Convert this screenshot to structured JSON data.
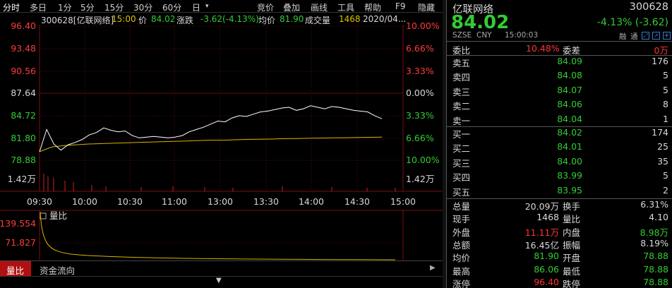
{
  "toolbar": {
    "left_items": [
      "分时",
      "多日",
      "1分",
      "5分",
      "15分",
      "30分",
      "60分",
      "日"
    ],
    "right_items": [
      "竞价",
      "叠加",
      "画线",
      "工具",
      "帮助",
      "F9",
      "隐藏"
    ]
  },
  "info": {
    "code_name": "300628[亿联网络]",
    "time": "15:00",
    "price_label": "价",
    "price": "84.02",
    "change_label": "涨跌",
    "change": "-3.62(-4.13%)",
    "avg_label": "均价",
    "avg": "81.90",
    "volume_label": "成交量",
    "volume": "1468",
    "date": "2020/04..."
  },
  "chart_data": {
    "type": "line",
    "y_left_ticks": [
      "96.40",
      "93.48",
      "90.56",
      "87.64",
      "84.72",
      "81.80",
      "78.88",
      "1.42万"
    ],
    "y_right_ticks": [
      "10.00%",
      "6.66%",
      "3.33%",
      "0.00%",
      "3.33%",
      "6.66%",
      "10.00%",
      "1.42万"
    ],
    "x_ticks": [
      "09:30",
      "10:00",
      "10:30",
      "11:00",
      "13:00",
      "13:30",
      "14:00",
      "14:30",
      "15:00"
    ],
    "ylim": [
      78.88,
      96.4
    ],
    "prev_close": 87.64,
    "series": [
      {
        "color": "#ffffff",
        "values": [
          80.0,
          82.9,
          81.0,
          80.2,
          80.9,
          81.2,
          81.6,
          82.2,
          82.5,
          83.1,
          82.8,
          82.6,
          82.7,
          82.1,
          81.8,
          81.9,
          82.0,
          81.9,
          81.8,
          81.9,
          82.1,
          82.6,
          82.9,
          83.2,
          83.6,
          84.0,
          83.9,
          84.4,
          84.7,
          84.6,
          84.9,
          85.2,
          85.3,
          85.5,
          85.7,
          85.8,
          85.4,
          85.6,
          86.0,
          85.8,
          85.6,
          85.9,
          85.8,
          85.6,
          85.4,
          85.3,
          85.2,
          84.7,
          84.3
        ]
      },
      {
        "color": "#d8b400",
        "values": [
          80.0,
          80.6,
          80.8,
          80.9,
          81.0,
          81.05,
          81.1,
          81.15,
          81.2,
          81.25,
          81.3,
          81.35,
          81.4,
          81.45,
          81.5,
          81.5,
          81.55,
          81.6,
          81.62,
          81.65,
          81.7,
          81.72,
          81.75,
          81.78,
          81.8,
          81.82,
          81.85,
          81.88,
          81.9
        ]
      }
    ],
    "sub_ticks": [
      "139.554",
      "71.827"
    ],
    "sub_label": "量比"
  },
  "bottom_tabs": [
    "量比",
    "资金流向"
  ],
  "quote": {
    "name": "亿联网络",
    "code": "300628",
    "price": "84.02",
    "pct": "-4.13% (-3.62)",
    "exchange": "SZSE",
    "currency": "CNY",
    "time": "15:00:03",
    "flags": [
      "融",
      "通"
    ],
    "weibi_label": "委比",
    "weibi": "10.48%",
    "weicha_label": "委差",
    "weicha": "0万",
    "asks": [
      {
        "label": "卖五",
        "price": "84.09",
        "vol": "176"
      },
      {
        "label": "卖四",
        "price": "84.08",
        "vol": "5"
      },
      {
        "label": "卖三",
        "price": "84.07",
        "vol": "5"
      },
      {
        "label": "卖二",
        "price": "84.06",
        "vol": "8"
      },
      {
        "label": "卖一",
        "price": "84.04",
        "vol": "1"
      }
    ],
    "bids": [
      {
        "label": "买一",
        "price": "84.02",
        "vol": "174"
      },
      {
        "label": "买二",
        "price": "84.01",
        "vol": "25"
      },
      {
        "label": "买三",
        "price": "84.00",
        "vol": "35"
      },
      {
        "label": "买四",
        "price": "83.99",
        "vol": "5"
      },
      {
        "label": "买五",
        "price": "83.95",
        "vol": "2"
      }
    ],
    "stats": [
      {
        "l1": "总量",
        "v1": "20.09万",
        "c1": "w",
        "l2": "换手",
        "v2": "6.31%",
        "c2": "w"
      },
      {
        "l1": "现手",
        "v1": "1468",
        "c1": "w",
        "l2": "量比",
        "v2": "4.10",
        "c2": "w"
      },
      {
        "l1": "外盘",
        "v1": "11.11万",
        "c1": "r",
        "l2": "内盘",
        "v2": "8.98万",
        "c2": "g"
      },
      {
        "l1": "总额",
        "v1": "16.45亿",
        "c1": "w",
        "l2": "振幅",
        "v2": "8.19%",
        "c2": "w"
      },
      {
        "l1": "均价",
        "v1": "81.90",
        "c1": "g",
        "l2": "开盘",
        "v2": "78.88",
        "c2": "g"
      },
      {
        "l1": "最高",
        "v1": "86.06",
        "c1": "g",
        "l2": "最低",
        "v2": "78.88",
        "c2": "g"
      },
      {
        "l1": "涨停",
        "v1": "96.40",
        "c1": "r",
        "l2": "跌停",
        "v2": "78.88",
        "c2": "g"
      }
    ]
  }
}
